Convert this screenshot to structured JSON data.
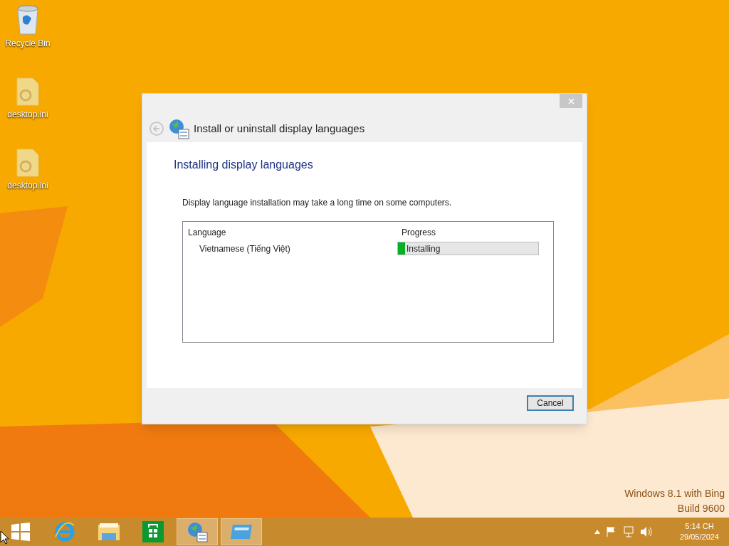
{
  "desktop_icons": [
    {
      "kind": "recycle",
      "label": "Recycle Bin"
    },
    {
      "kind": "file",
      "label": "desktop.ini"
    },
    {
      "kind": "file",
      "label": "desktop.ini"
    }
  ],
  "dialog": {
    "title": "Install or uninstall display languages",
    "heading": "Installing display languages",
    "note": "Display language installation may take a long time on some computers.",
    "columns": [
      "Language",
      "Progress"
    ],
    "rows": [
      {
        "language": "Vietnamese (Tiếng Việt)",
        "status": "Installing",
        "level": 0.05
      }
    ],
    "buttons": [
      "Cancel"
    ]
  },
  "taskbar": {
    "apps": [
      {
        "kind": "start",
        "selected": false
      },
      {
        "kind": "ie",
        "selected": false
      },
      {
        "kind": "explorer",
        "selected": false
      },
      {
        "kind": "store",
        "selected": false
      },
      {
        "kind": "language",
        "selected": true
      },
      {
        "kind": "window",
        "selected": true
      }
    ],
    "time": "5:14 CH",
    "date": "29/05/2024"
  },
  "os_watermark": [
    "Windows 8.1 with Bing",
    "Build 9600"
  ]
}
